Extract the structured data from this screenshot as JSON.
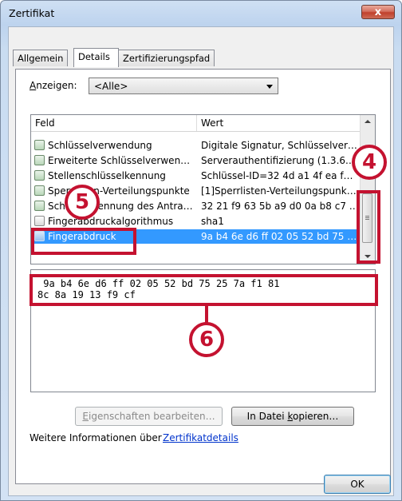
{
  "window": {
    "title": "Zertifikat",
    "close_glyph": "x"
  },
  "tabs": [
    {
      "label": "Allgemein"
    },
    {
      "label": "Details"
    },
    {
      "label": "Zertifizierungspfad"
    }
  ],
  "show": {
    "label_prefix": "A",
    "label_rest": "nzeigen:",
    "selected": "<Alle>"
  },
  "list": {
    "columns": [
      "Feld",
      "Wert"
    ],
    "rows": [
      {
        "feld": "Schlüsselverwendung",
        "wert": "Digitale Signatur, Schlüsselver…"
      },
      {
        "feld": "Erweiterte Schlüsselverwen…",
        "wert": "Serverauthentifizierung (1.3.6.…"
      },
      {
        "feld": "Stellenschlüsselkennung",
        "wert": "Schlüssel-ID=32 4d a1 4f ea f…"
      },
      {
        "feld": "Sperrlisten-Verteilungspunkte",
        "wert": "[1]Sperrlisten-Verteilungspunk…"
      },
      {
        "feld": "Schlüsselkennung des Antra…",
        "wert": "32 21 f9 63 5b a9 d0 0a b8 c7 …"
      },
      {
        "feld": "Fingerabdruckalgorithmus",
        "wert": "sha1"
      },
      {
        "feld": "Fingerabdruck",
        "wert": "9a b4 6e d6 ff 02 05 52 bd 75 …"
      }
    ]
  },
  "details": {
    "line1": " 9a b4 6e d6 ff 02 05 52 bd 75 25 7a f1 81",
    "line2": "8c 8a 19 13 f9 cf"
  },
  "buttons": {
    "edit_prefix": "E",
    "edit_rest": "igenschaften bearbeiten…",
    "copy_prefix": "In Datei ",
    "copy_u": "k",
    "copy_rest": "opieren…",
    "ok": "OK"
  },
  "info": {
    "text": "Weitere Informationen über",
    "link": "Zertifikatdetails"
  },
  "annotations": {
    "a4": "4",
    "a5": "5",
    "a6": "6"
  },
  "colors": {
    "accent_red": "#c41230",
    "selection": "#3399ff"
  }
}
